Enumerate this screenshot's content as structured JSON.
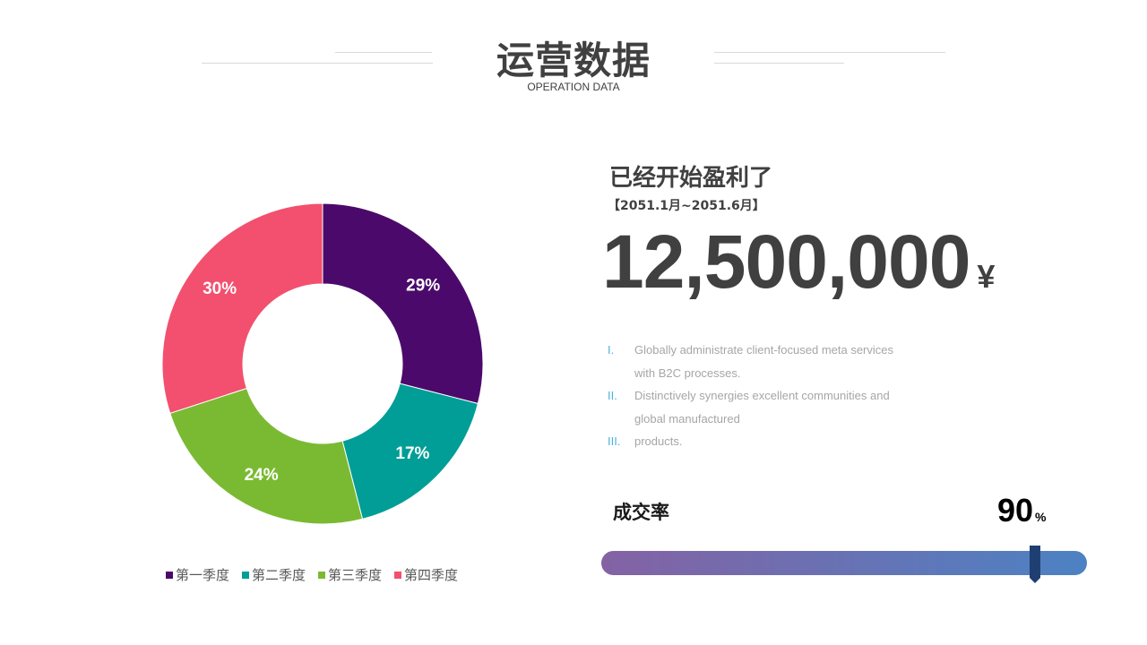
{
  "header": {
    "title": "运营数据",
    "subtitle": "OPERATION DATA"
  },
  "chart_data": {
    "type": "pie",
    "hole": true,
    "start_angle_deg": 0,
    "direction": "clockwise",
    "categories": [
      "第一季度",
      "第二季度",
      "第三季度",
      "第四季度"
    ],
    "values": [
      29,
      17,
      24,
      30
    ],
    "labels": [
      "29%",
      "17%",
      "24%",
      "30%"
    ],
    "colors": [
      "#4b0a6b",
      "#009e96",
      "#7aba33",
      "#f2506e"
    ],
    "legend_position": "bottom"
  },
  "summary": {
    "headline": "已经开始盈利了",
    "period": "【2051.1月~2051.6月】",
    "amount": "12,500,000",
    "currency": "¥"
  },
  "bullets": [
    {
      "num": "I.",
      "lines": [
        "Globally administrate client-focused meta services",
        "with B2C processes."
      ]
    },
    {
      "num": "II.",
      "lines": [
        "Distinctively synergies excellent communities and",
        "global manufactured"
      ]
    },
    {
      "num": "III.",
      "lines": [
        "products."
      ]
    }
  ],
  "conversion": {
    "label": "成交率",
    "value": "90",
    "unit": "%",
    "fraction": 0.9,
    "gradient_start": "#8462a4",
    "gradient_end": "#4c82c3",
    "marker_color": "#1f3f73"
  }
}
